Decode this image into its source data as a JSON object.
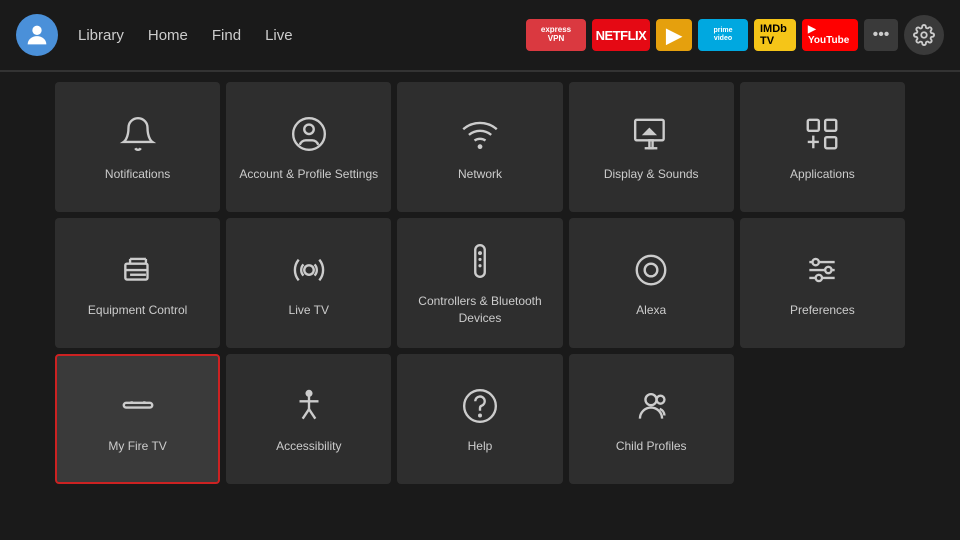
{
  "nav": {
    "links": [
      "Library",
      "Home",
      "Find",
      "Live"
    ],
    "apps": [
      {
        "name": "ExpressVPN",
        "class": "badge-expressvpn",
        "label": "express\nVPN"
      },
      {
        "name": "Netflix",
        "class": "badge-netflix",
        "label": "NETFLIX"
      },
      {
        "name": "Plex",
        "class": "badge-plex",
        "label": "▶"
      },
      {
        "name": "Prime Video",
        "class": "badge-prime",
        "label": "prime\nvideo"
      },
      {
        "name": "IMDb TV",
        "class": "badge-imdb",
        "label": "IMDb TV"
      },
      {
        "name": "YouTube",
        "class": "badge-youtube",
        "label": "▶ YouTube"
      }
    ]
  },
  "settings": {
    "title": "Settings",
    "cells": [
      {
        "id": "notifications",
        "label": "Notifications",
        "icon": "bell",
        "selected": false
      },
      {
        "id": "account",
        "label": "Account & Profile Settings",
        "icon": "person-circle",
        "selected": false
      },
      {
        "id": "network",
        "label": "Network",
        "icon": "wifi",
        "selected": false
      },
      {
        "id": "display",
        "label": "Display & Sounds",
        "icon": "display-sound",
        "selected": false
      },
      {
        "id": "applications",
        "label": "Applications",
        "icon": "apps",
        "selected": false
      },
      {
        "id": "equipment",
        "label": "Equipment Control",
        "icon": "tv-remote",
        "selected": false
      },
      {
        "id": "livetv",
        "label": "Live TV",
        "icon": "antenna",
        "selected": false
      },
      {
        "id": "controllers",
        "label": "Controllers & Bluetooth Devices",
        "icon": "remote",
        "selected": false
      },
      {
        "id": "alexa",
        "label": "Alexa",
        "icon": "alexa",
        "selected": false
      },
      {
        "id": "preferences",
        "label": "Preferences",
        "icon": "sliders",
        "selected": false
      },
      {
        "id": "myfiretv",
        "label": "My Fire TV",
        "icon": "firestick",
        "selected": true
      },
      {
        "id": "accessibility",
        "label": "Accessibility",
        "icon": "accessibility",
        "selected": false
      },
      {
        "id": "help",
        "label": "Help",
        "icon": "help",
        "selected": false
      },
      {
        "id": "childprofiles",
        "label": "Child Profiles",
        "icon": "child-profiles",
        "selected": false
      }
    ]
  }
}
